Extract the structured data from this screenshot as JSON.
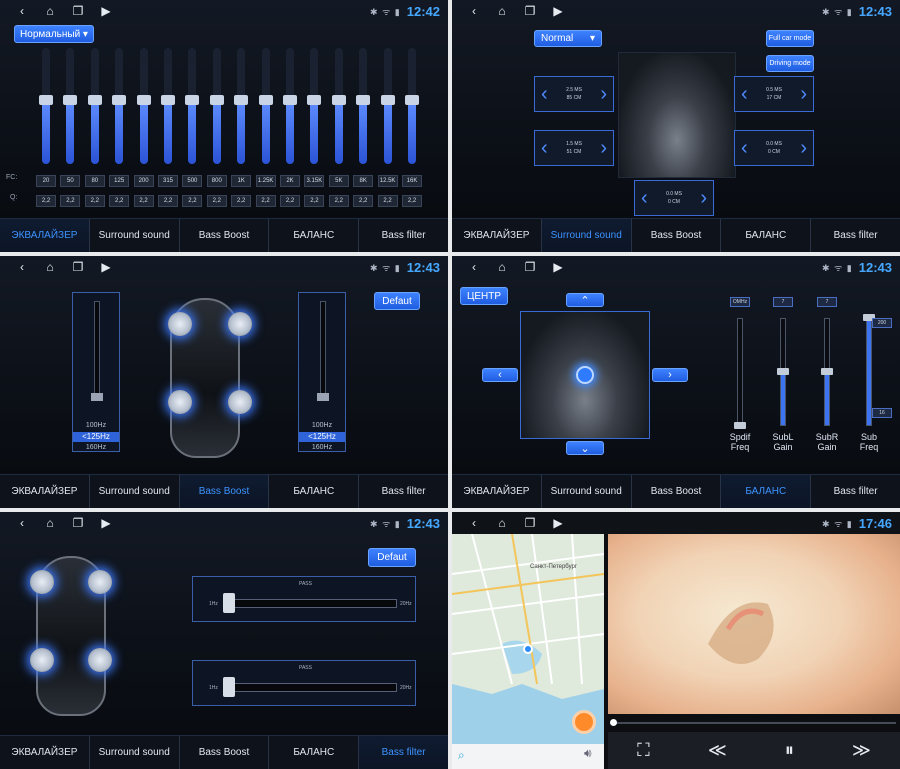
{
  "colors": {
    "accent": "#3d93ff",
    "clock": "#46a7ff",
    "panel_bg": "#0b0f16"
  },
  "tabs": [
    "ЭКВАЛАЙЗЕР",
    "Surround sound",
    "Bass Boost",
    "БАЛАНС",
    "Bass filter"
  ],
  "icons": {
    "back": "‹",
    "home": "⌂",
    "recent": "❐",
    "play": "▶",
    "status": "✱ ᯤ ▮"
  },
  "p1": {
    "time": "12:42",
    "preset": "Нормальный",
    "fc_label": "FC:",
    "q_label": "Q:",
    "fc": [
      "20",
      "50",
      "80",
      "125",
      "200",
      "315",
      "500",
      "800",
      "1K",
      "1.25K",
      "2K",
      "3.15K",
      "5K",
      "8K",
      "12.5K",
      "16K"
    ],
    "q": [
      "2,2",
      "2,2",
      "2,2",
      "2,2",
      "2,2",
      "2,2",
      "2,2",
      "2,2",
      "2,2",
      "2,2",
      "2,2",
      "2,2",
      "2,2",
      "2,2",
      "2,2",
      "2,2"
    ],
    "levels": [
      0.55,
      0.55,
      0.55,
      0.55,
      0.55,
      0.55,
      0.55,
      0.55,
      0.55,
      0.55,
      0.55,
      0.55,
      0.55,
      0.55,
      0.55,
      0.55
    ]
  },
  "p2": {
    "time": "12:43",
    "preset": "Normal",
    "full_car": "Full car mode",
    "driving": "Driving mode",
    "fl": {
      "ms": "2.5 MS",
      "cm": "85 CM"
    },
    "fr": {
      "ms": "0.5 MS",
      "cm": "17 CM"
    },
    "rl": {
      "ms": "1.5 MS",
      "cm": "51 CM"
    },
    "rr": {
      "ms": "0.0 MS",
      "cm": "0 CM"
    },
    "sub": {
      "ms": "0.0 MS",
      "cm": "0 CM"
    }
  },
  "p3": {
    "time": "12:43",
    "default": "Defaut",
    "opts": [
      "100Hz",
      "<125Hz",
      "160Hz"
    ]
  },
  "p4": {
    "time": "12:43",
    "center": "ЦЕНТР",
    "tags": [
      "OMHz",
      "7",
      "7"
    ],
    "sub_top": "200",
    "sub_bot": "16",
    "labels": [
      "Spdif\nFreq",
      "SubL\nGain",
      "SubR\nGain",
      "Sub\nFreq"
    ],
    "levels": [
      0.0,
      0.5,
      0.5,
      1.0
    ]
  },
  "p5": {
    "time": "12:43",
    "default": "Defaut",
    "pass": "PASS",
    "hz_left": "1Hz",
    "hz_right": "20Hz",
    "hz_left2": "1Hz",
    "hz_right2": "20Hz"
  },
  "p6": {
    "time": "17:46",
    "map_label": "Санкт-Петербург",
    "prev": "≪",
    "pause": "⏸",
    "next": "≫",
    "fit": "⛶"
  }
}
